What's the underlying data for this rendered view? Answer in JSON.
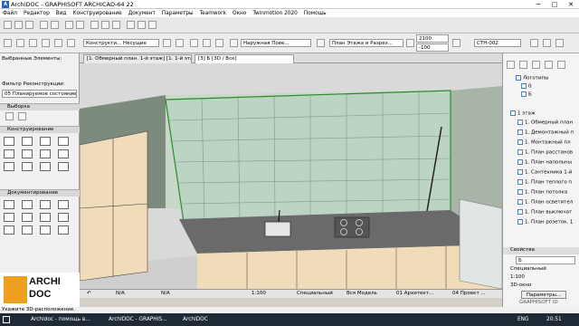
{
  "window": {
    "title": "ArchiDOC - GRAPHISOFT ARCHICAD-64 22",
    "app_badge": "A",
    "minimize": "─",
    "maximize": "□",
    "close": "✕"
  },
  "menu": [
    "Файл",
    "Редактор",
    "Вид",
    "Конструирование",
    "Документ",
    "Параметры",
    "Teamwork",
    "Окно",
    "Twinmotion 2020",
    "Помощь"
  ],
  "toolbar": {
    "layer_field": "Конструкти... Несущие",
    "layer_field2": "Наружная Пове...",
    "plan_field": "План Этажа и Разрез...",
    "height_top": "2100",
    "height_bottom": "-100",
    "id_field": "СТН-002"
  },
  "left_panel": {
    "selected_label": "Выбранные Элементы:",
    "filter_label": "Фильтр Реконструкции:",
    "filter_value": "05 Планируемое состояние",
    "sections": [
      "Выборка",
      "Конструирование",
      "Документирование"
    ]
  },
  "logo": {
    "line1": "ARCHI",
    "line2": "DOC"
  },
  "tabs": [
    {
      "label": "[1. Обмерный план. 1-й этаж]  [1. 1-й эта..."
    },
    {
      "label": "[3] Б [3D / Все]"
    }
  ],
  "bottom_bar": {
    "scale": "1:100",
    "layer_combo": "Специальный",
    "model": "Вся Модель",
    "view": "01 Архитект...",
    "projection": "04 Проект ...",
    "zoom_a": "N/A",
    "zoom_b": "N/A"
  },
  "status": {
    "text": "Укажите 3D-расположение."
  },
  "right_panel": {
    "tree": [
      "Логотипы",
      "0",
      "Б",
      "1 этаж",
      "1. Обмерный план",
      "1. Демонтажный п",
      "1. Монтажный пл",
      "1. План расстанов",
      "1. План напольны",
      "1. Сантехника 1-й",
      "1. План теплого п",
      "1. План потолка",
      "1. План осветител",
      "1. План выключат",
      "1. План розеток. 1"
    ],
    "properties_title": "Свойства",
    "prop_value": "Б",
    "prop_layer": "Специальный",
    "prop_scale": "1:100",
    "prop_window": "3D-окно",
    "params_button": "Параметры...",
    "brand": "GRAPHISOFT ID"
  },
  "taskbar": {
    "items": [
      "Archidoc - помощь в...",
      "ArchiDOC - GRAPHIS...",
      "ArchiDOC"
    ],
    "lang": "ENG",
    "time": "20:51"
  }
}
